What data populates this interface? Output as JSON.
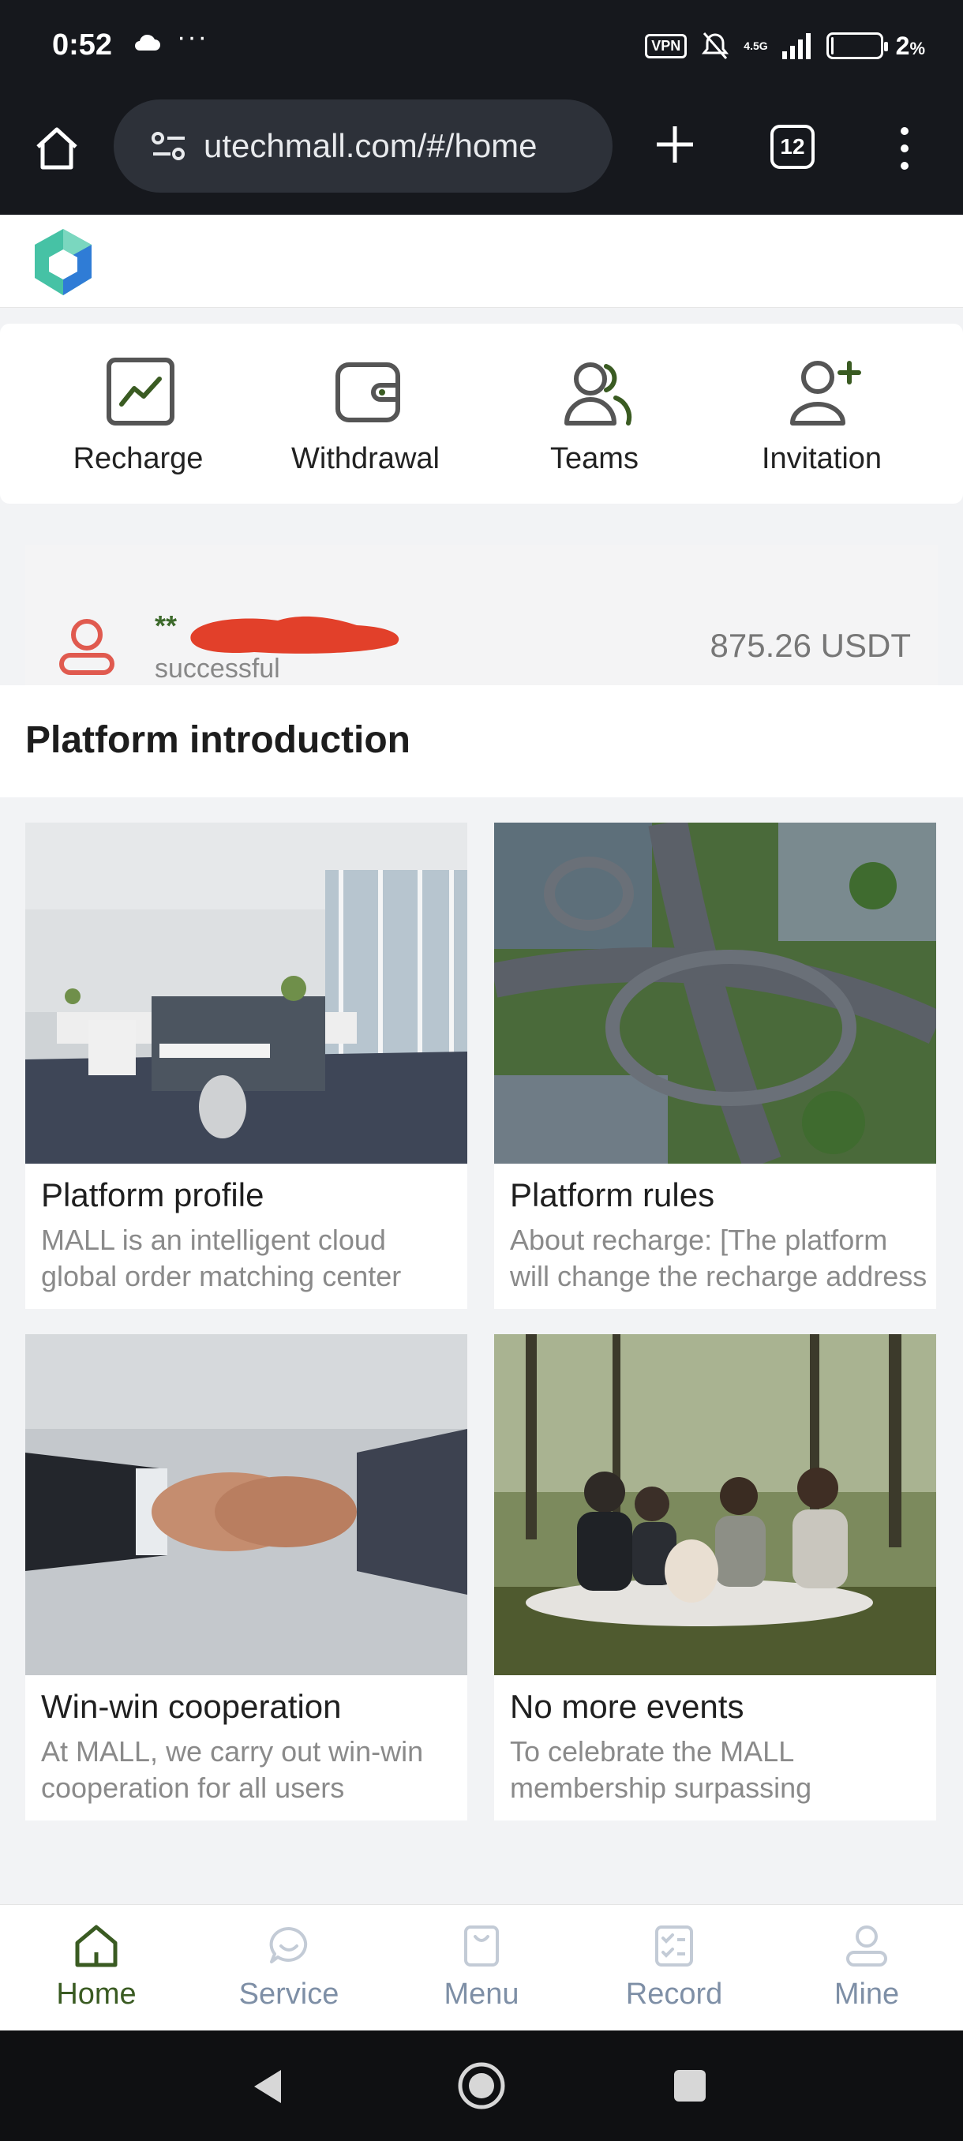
{
  "status_bar": {
    "time": "0:52",
    "dots": "···",
    "vpn": "VPN",
    "network": "4.5G",
    "battery_percent": "2",
    "battery_suffix": "%",
    "battery_level": 0.02
  },
  "browser": {
    "url": "utechmall.com/#/home",
    "tab_count": "12"
  },
  "quick_actions": [
    {
      "label": "Recharge",
      "icon": "chart-line-icon"
    },
    {
      "label": "Withdrawal",
      "icon": "wallet-icon"
    },
    {
      "label": "Teams",
      "icon": "users-icon"
    },
    {
      "label": "Invitation",
      "icon": "user-plus-icon"
    }
  ],
  "account": {
    "name_prefix": "**",
    "status": "successful",
    "balance": "875.26 USDT"
  },
  "intro": {
    "title": "Platform introduction"
  },
  "cards": [
    {
      "title": "Platform profile",
      "desc": "MALL is an intelligent cloud global order matching center"
    },
    {
      "title": "Platform rules",
      "desc": "About recharge: [The platform will change the recharge address"
    },
    {
      "title": "Win-win cooperation",
      "desc": "At MALL, we carry out win-win cooperation for all users"
    },
    {
      "title": "No more events",
      "desc": "To celebrate the MALL membership surpassing"
    }
  ],
  "tabbar": [
    {
      "label": "Home",
      "icon": "home-icon",
      "active": true
    },
    {
      "label": "Service",
      "icon": "chat-icon",
      "active": false
    },
    {
      "label": "Menu",
      "icon": "bag-icon",
      "active": false
    },
    {
      "label": "Record",
      "icon": "checklist-icon",
      "active": false
    },
    {
      "label": "Mine",
      "icon": "user-icon",
      "active": false
    }
  ],
  "colors": {
    "accent_active": "#3a5b22",
    "inactive_tab": "#7e8fa6",
    "account_icon": "#e05a4f",
    "redaction": "#e2402a"
  }
}
